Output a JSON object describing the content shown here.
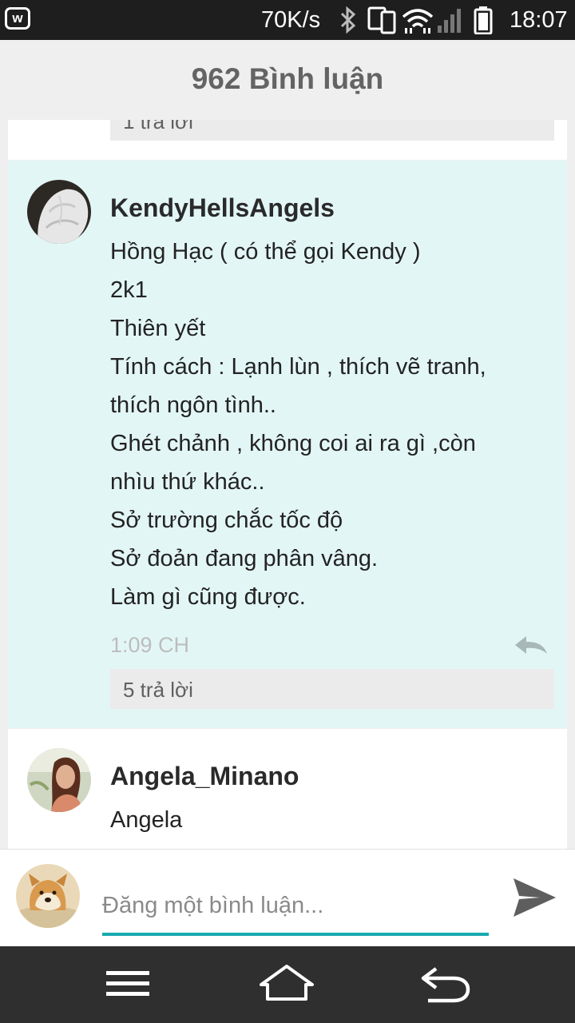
{
  "status_bar": {
    "net_speed": "70K/s",
    "time": "18:07",
    "icons": [
      "app-w-icon",
      "bluetooth-icon",
      "phone-link-icon",
      "wifi-icon",
      "signal-icon",
      "battery-icon"
    ]
  },
  "header": {
    "title": "962 Bình luận"
  },
  "comments": [
    {
      "reply_count": "1 trả lời"
    },
    {
      "username": "KendyHellsAngels",
      "lines": [
        "Hồng Hạc ( có thể gọi Kendy )",
        "2k1",
        "Thiên yết",
        "Tính cách : Lạnh lùn , thích vẽ tranh,",
        "thích ngôn tình..",
        "Ghét chảnh , không coi ai ra gì ,còn",
        "nhìu thứ khác..",
        "Sở trường chắc tốc độ",
        "Sở đoản đang phân vâng.",
        "Làm gì cũng được."
      ],
      "time": "1:09 CH",
      "reply_count": "5 trả lời",
      "highlight_color": "#e3f6f6"
    },
    {
      "username": "Angela_Minano",
      "lines": [
        "Angela"
      ]
    }
  ],
  "composer": {
    "placeholder": "Đăng một bình luận...",
    "accent_color": "#19a9b0"
  },
  "nav_bar": {
    "icons": [
      "menu-icon",
      "home-icon",
      "back-icon"
    ]
  }
}
